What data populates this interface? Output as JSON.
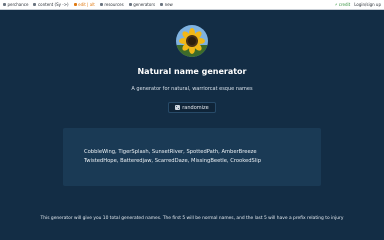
{
  "topbar": {
    "nav": [
      {
        "label": "perchance",
        "icon": "home-icon"
      },
      {
        "label": "content (Sy ->)",
        "icon": "code-icon"
      },
      {
        "label": "edit | alt",
        "icon": "edit-icon",
        "active": true
      },
      {
        "label": "resources",
        "icon": "book-icon"
      },
      {
        "label": "generators",
        "icon": "grid-icon"
      },
      {
        "label": "new",
        "icon": "plus-icon"
      }
    ],
    "credits": "⚡ credit",
    "login": "Login/sign up"
  },
  "avatar": {
    "icon": "sunflower-avatar"
  },
  "page_title": "Natural name generator",
  "subtitle": "A generator for natural, warriorcat esque names",
  "randomize": {
    "label": "randomize",
    "icon": "dice-icon"
  },
  "results": {
    "lines": [
      "CobbleWing, TigerSplash, SunsetRiver, SpottedPath, AmberBreeze",
      "TwistedHope, Batteredjaw, ScarredDaze, MissingBeetle, CrookedSlip"
    ]
  },
  "footer": "This generator will give you 10 total generated names. The first 5 will be normal names, and the last 5 will have a prefix relating to injury",
  "colors": {
    "background": "#132d45",
    "panel": "#1a3a55",
    "accent": "#e07a12"
  }
}
